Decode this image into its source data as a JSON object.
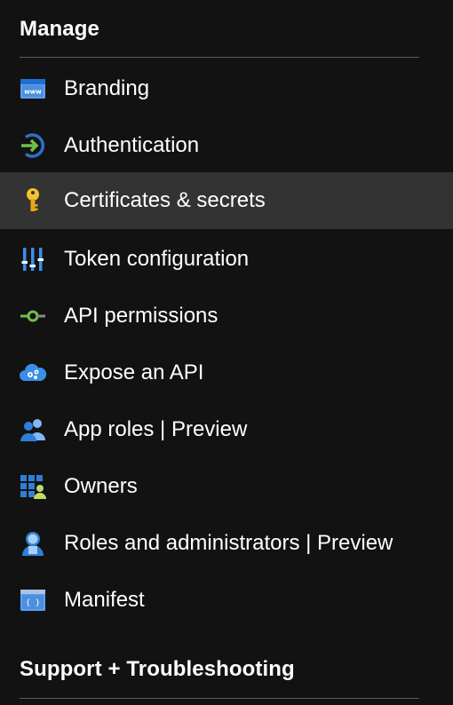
{
  "manage": {
    "header": "Manage",
    "items": [
      {
        "label": "Branding",
        "icon": "branding-window-icon",
        "selected": false
      },
      {
        "label": "Authentication",
        "icon": "authentication-arrow-icon",
        "selected": false
      },
      {
        "label": "Certificates & secrets",
        "icon": "key-icon",
        "selected": true
      },
      {
        "label": "Token configuration",
        "icon": "sliders-icon",
        "selected": false
      },
      {
        "label": "API permissions",
        "icon": "api-permissions-icon",
        "selected": false
      },
      {
        "label": "Expose an API",
        "icon": "cloud-gear-icon",
        "selected": false
      },
      {
        "label": "App roles | Preview",
        "icon": "users-icon",
        "selected": false
      },
      {
        "label": "Owners",
        "icon": "owners-grid-icon",
        "selected": false
      },
      {
        "label": "Roles and administrators | Preview",
        "icon": "admin-user-icon",
        "selected": false
      },
      {
        "label": "Manifest",
        "icon": "manifest-code-icon",
        "selected": false
      }
    ]
  },
  "support": {
    "header": "Support + Troubleshooting"
  },
  "colors": {
    "background": "#121212",
    "selected_background": "#333333",
    "divider": "#5a5a5a",
    "text": "#ffffff"
  }
}
